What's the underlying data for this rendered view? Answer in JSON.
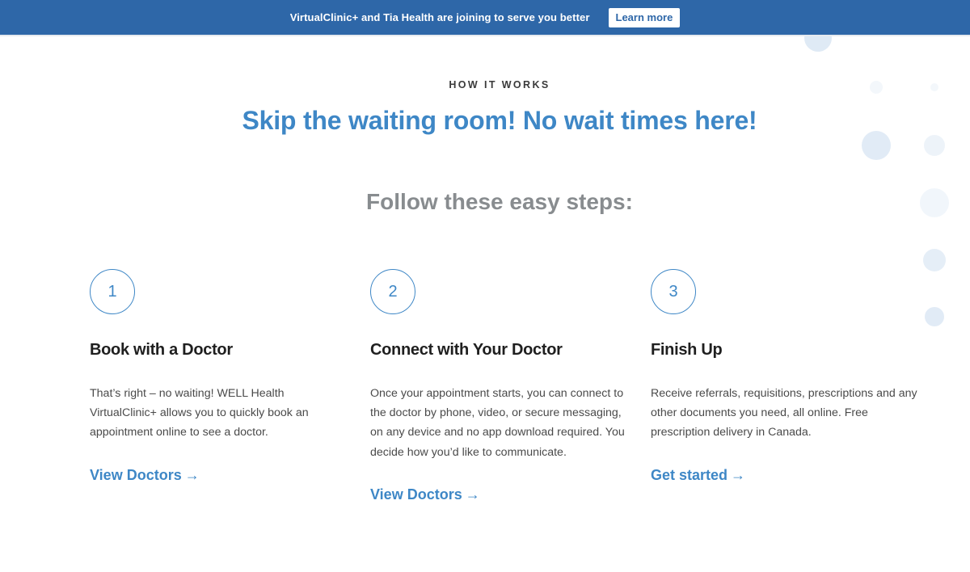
{
  "banner": {
    "message": "VirtualClinic+ and Tia Health are joining to serve you better",
    "button_label": "Learn more"
  },
  "section": {
    "eyebrow": "HOW IT WORKS",
    "headline": "Skip the waiting room! No wait times here!",
    "subhead": "Follow these easy steps:"
  },
  "steps": [
    {
      "number": "1",
      "title": "Book with a Doctor",
      "description": "That’s right – no waiting! WELL Health VirtualClinic+ allows you to quickly book an appointment online to see a doctor.",
      "link_label": "View Doctors",
      "link_icon": "→"
    },
    {
      "number": "2",
      "title": "Connect with Your Doctor",
      "description": "Once your appointment starts, you can connect to the doctor by phone, video, or secure messaging, on any device and no app download required. You decide how you’d like to communicate.",
      "link_label": "View Doctors",
      "link_icon": "→"
    },
    {
      "number": "3",
      "title": "Finish Up",
      "description": "Receive referrals, requisitions, prescriptions and any other documents you need, all online. Free prescription delivery in Canada.",
      "link_label": "Get started",
      "link_icon": "→"
    }
  ],
  "colors": {
    "banner_bg": "#2e67a8",
    "accent": "#3e87c6",
    "subhead": "#888c8f",
    "decor_dot": "#dce8f4"
  }
}
